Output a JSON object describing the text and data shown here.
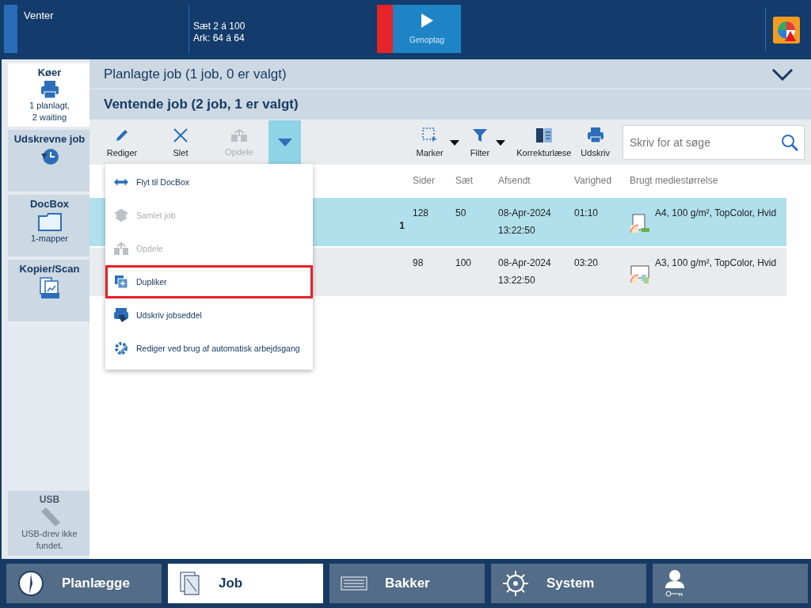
{
  "status": {
    "title": "Venter",
    "progress": [
      "Sæt 2 á 100",
      "Ark: 64 á 64"
    ],
    "resume": "Genoptag",
    "stopped": true
  },
  "sidebar": {
    "items": [
      {
        "kind": "queue",
        "title": "Køer",
        "lines": [
          "1 planlagt,",
          "2 waiting"
        ],
        "selected": true
      },
      {
        "kind": "history",
        "title": "Udskrevne job",
        "selected": false
      },
      {
        "kind": "docbox",
        "title": "DocBox",
        "lines": [
          "1-mapper"
        ],
        "selected": false
      },
      {
        "kind": "copy",
        "title": "Kopier/Scan",
        "selected": false
      }
    ],
    "usb": {
      "title": "USB",
      "lines": [
        "USB-drev ikke",
        "fundet."
      ]
    }
  },
  "planned": {
    "title": "Planlagte job (1 job, 0 er valgt)"
  },
  "waiting": {
    "title": "Ventende job (2 job, 1 er valgt)"
  },
  "toolbar": {
    "left": [
      {
        "kind": "edit",
        "label": "Rediger",
        "disabled": false
      },
      {
        "kind": "delete",
        "label": "Slet",
        "disabled": false
      },
      {
        "kind": "split",
        "label": "Opdele",
        "disabled": true
      },
      {
        "kind": "more",
        "expanded": true
      }
    ],
    "right": [
      {
        "kind": "select",
        "label": "Marker",
        "caret": true
      },
      {
        "kind": "filter",
        "label": "Filter",
        "caret": true
      },
      {
        "kind": "proof",
        "label": "Korrekturlæse",
        "caret": false
      },
      {
        "kind": "print",
        "label": "Udskriv",
        "caret": false
      }
    ],
    "search": {
      "placeholder": "Skriv for at søge"
    }
  },
  "table": {
    "columns": [
      "Sider",
      "Sæt",
      "Afsendt",
      "Varighed",
      "Brugt mediestørrelse"
    ],
    "rows": [
      {
        "selected": true,
        "column_1": "1",
        "pages": "128",
        "sets": "50",
        "date": "08-Apr-2024",
        "time": "13:22:50",
        "duration": "01:10",
        "media": {
          "kind": "single",
          "label": "A4, 100 g/m², TopColor, Hvid"
        }
      },
      {
        "selected": false,
        "pages": "98",
        "sets": "100",
        "date": "08-Apr-2024",
        "time": "13:22:50",
        "duration": "03:20",
        "media": {
          "kind": "multi",
          "label": "A3, 100 g/m², TopColor, Hvid"
        }
      }
    ]
  },
  "menu": {
    "items": [
      {
        "kind": "move",
        "label": "Flyt til DocBox",
        "disabled": false,
        "highlighted": false
      },
      {
        "kind": "collate",
        "label": "Samlet job",
        "disabled": true,
        "highlighted": false
      },
      {
        "kind": "split",
        "label": "Opdele",
        "disabled": true,
        "highlighted": false
      },
      {
        "kind": "duplicate",
        "label": "Dupliker",
        "disabled": false,
        "highlighted": true
      },
      {
        "kind": "ticket",
        "label": "Udskriv jobseddel",
        "disabled": false,
        "highlighted": false
      },
      {
        "kind": "workflow",
        "label": "Rediger ved brug af automatisk arbejdsgang",
        "disabled": false,
        "highlighted": false
      }
    ]
  },
  "nav": [
    {
      "kind": "schedule",
      "label": "Planlægge",
      "selected": false
    },
    {
      "kind": "job",
      "label": "Job",
      "selected": true
    },
    {
      "kind": "trays",
      "label": "Bakker",
      "selected": false
    },
    {
      "kind": "system",
      "label": "System",
      "selected": false
    },
    {
      "kind": "user",
      "selected": false
    }
  ]
}
